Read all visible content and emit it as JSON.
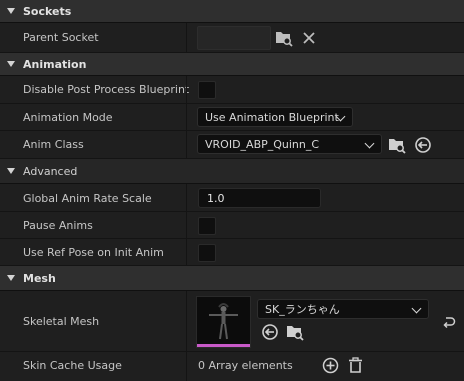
{
  "sections": {
    "sockets": "Sockets",
    "animation": "Animation",
    "advanced": "Advanced",
    "mesh": "Mesh"
  },
  "sockets": {
    "parent_socket_label": "Parent Socket"
  },
  "animation": {
    "disable_pp_label": "Disable Post Process Blueprint",
    "anim_mode_label": "Animation Mode",
    "anim_mode_value": "Use Animation Blueprint",
    "anim_class_label": "Anim Class",
    "anim_class_value": "VROID_ABP_Quinn_C"
  },
  "advanced": {
    "global_rate_label": "Global Anim Rate Scale",
    "global_rate_value": "1.0",
    "pause_anims_label": "Pause Anims",
    "ref_pose_label": "Use Ref Pose on Init Anim"
  },
  "mesh": {
    "skeletal_mesh_label": "Skeletal Mesh",
    "skeletal_mesh_value": "SK_ランちゃん",
    "skin_cache_label": "Skin Cache Usage",
    "skin_cache_value": "0 Array elements"
  },
  "colors": {
    "panel_bg": "#1f1f1f",
    "section_bg": "#2f2f2f",
    "field_bg": "#0f0f0f",
    "thumb_accent": "#c85ac8"
  }
}
